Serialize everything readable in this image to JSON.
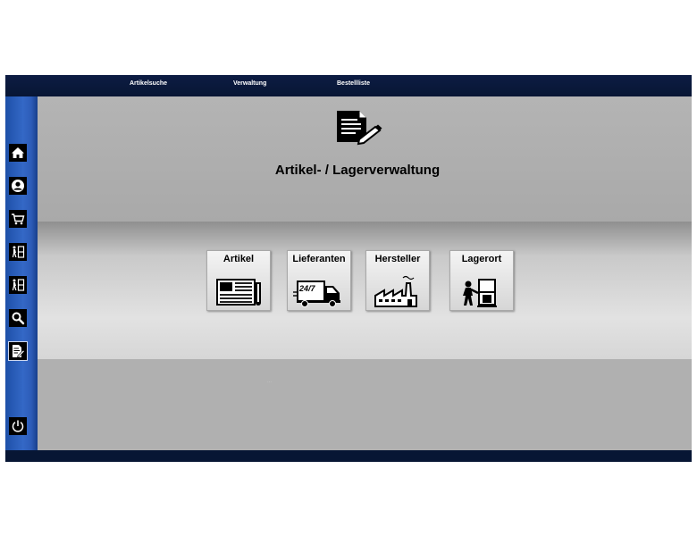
{
  "topbar": {
    "items": [
      {
        "label": "Artikelsuche"
      },
      {
        "label": "Verwaltung"
      },
      {
        "label": "Bestellliste"
      }
    ]
  },
  "sidebar": {
    "items": [
      {
        "icon": "home-icon"
      },
      {
        "icon": "user-icon"
      },
      {
        "icon": "cart-icon"
      },
      {
        "icon": "warehouse-worker-icon"
      },
      {
        "icon": "warehouse-worker-icon"
      },
      {
        "icon": "search-icon"
      },
      {
        "icon": "document-edit-icon",
        "active": true
      },
      {
        "icon": "power-icon"
      }
    ]
  },
  "main": {
    "title": "Artikel- / Lagerverwaltung",
    "tiles": [
      {
        "label": "Artikel",
        "icon": "newspaper-icon"
      },
      {
        "label": "Lieferanten",
        "icon": "delivery-truck-icon",
        "badge": "24/7"
      },
      {
        "label": "Hersteller",
        "icon": "factory-icon"
      },
      {
        "label": "Lagerort",
        "icon": "storage-location-icon"
      }
    ],
    "placeholder_mark": "..."
  },
  "colors": {
    "topbar": "#071634",
    "sidebar": "#2d5cb8",
    "content_bg": "#b0b0b0",
    "tile_bg": "#e8e8e8"
  }
}
